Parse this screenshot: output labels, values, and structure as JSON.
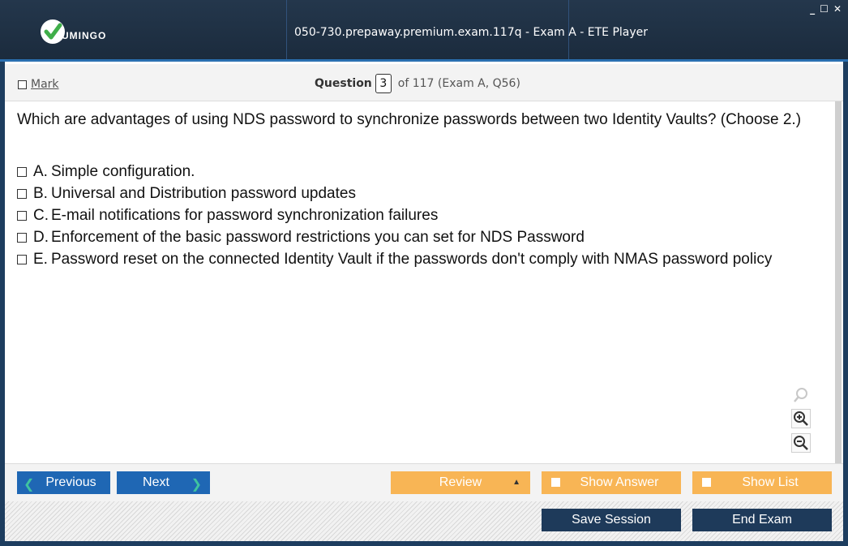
{
  "window": {
    "title": "050-730.prepaway.premium.exam.117q - Exam A - ETE Player",
    "controls": {
      "minimize": "_",
      "maximize": "☐",
      "close": "✕"
    }
  },
  "logo": {
    "word": "UMINGO",
    "icon": "checkmark-logo-icon"
  },
  "header": {
    "mark_label": "Mark",
    "question_label": "Question",
    "question_number": "3",
    "question_suffix": "of 117 (Exam A, Q56)"
  },
  "question": {
    "text": "Which are advantages of using NDS password to synchronize passwords between two Identity Vaults? (Choose 2.)",
    "options": [
      {
        "letter": "A.",
        "text": "Simple configuration."
      },
      {
        "letter": "B.",
        "text": "Universal and Distribution password updates"
      },
      {
        "letter": "C.",
        "text": "E-mail notifications for password synchronization failures"
      },
      {
        "letter": "D.",
        "text": "Enforcement of the basic password restrictions you can set for NDS Password"
      },
      {
        "letter": "E.",
        "text": "Password reset on the connected Identity Vault if the passwords don't comply with NMAS password policy"
      }
    ]
  },
  "zoom_tools": [
    "magnifier-icon",
    "zoom-in-icon",
    "zoom-out-icon"
  ],
  "nav": {
    "previous": "Previous",
    "next": "Next",
    "review": "Review",
    "show_answer": "Show Answer",
    "show_list": "Show List"
  },
  "footer": {
    "save_session": "Save Session",
    "end_exam": "End Exam"
  },
  "colors": {
    "titlebar": "#1b2b3d",
    "nav_blue": "#1f67b4",
    "orange": "#f8b555",
    "navy": "#1e3a5a"
  }
}
